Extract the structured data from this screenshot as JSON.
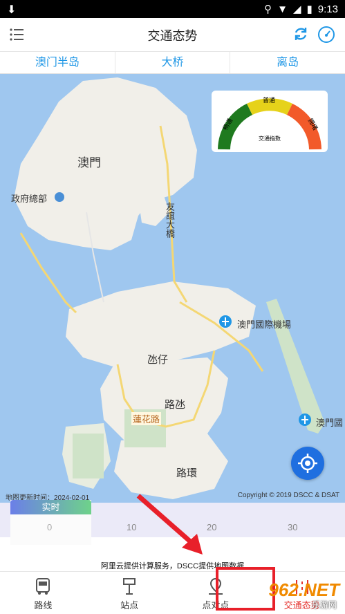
{
  "status_bar": {
    "time": "9:13"
  },
  "header": {
    "title": "交通态势"
  },
  "tabs": [
    {
      "label": "澳门半岛"
    },
    {
      "label": "大桥"
    },
    {
      "label": "离岛"
    }
  ],
  "map": {
    "labels": {
      "macau": "澳門",
      "gov_hq": "政府總部",
      "friendship_bridge": "友誼大橋",
      "taipa": "氹仔",
      "cotai": "路氹",
      "lotus_road": "蓮花路",
      "coloane": "路環",
      "airport": "澳門國際機場",
      "airport2": "澳門國"
    },
    "updated_text": "地图更新时间：2024-02-01",
    "copyright": "Copyright © 2019 DSCC & DSAT"
  },
  "traffic_gauge": {
    "smooth": "畅通",
    "normal": "普通",
    "congested": "拥堵",
    "index_label": "交通指数",
    "colors": {
      "smooth": "#1f7a1f",
      "normal": "#e6d21a",
      "congested": "#f25a2a"
    }
  },
  "timeline": {
    "live_label": "实时",
    "ticks": [
      "0",
      "10",
      "20",
      "30"
    ]
  },
  "credit": "阿里云提供计算服务，DSCC提供地图数据",
  "bottom_nav": [
    {
      "label": "路线"
    },
    {
      "label": "站点"
    },
    {
      "label": "点对点"
    },
    {
      "label": "交通态势"
    }
  ],
  "watermark": {
    "text": "962.NET",
    "sub": "乐游网"
  }
}
